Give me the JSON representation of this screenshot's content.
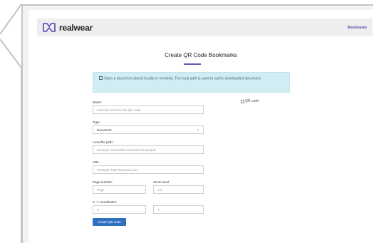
{
  "header": {
    "brand": "realwear",
    "nav_link": "Bookmarks"
  },
  "page": {
    "title": "Create QR Code Bookmarks"
  },
  "alert": {
    "text": "Open a document stored locally or remotely. The local path is used to cache downloaded document."
  },
  "form": {
    "name": {
      "label": "Name:",
      "placeholder": "Friendly name for the QR code"
    },
    "type": {
      "label": "Type:",
      "value": "Document"
    },
    "local_path": {
      "label": "Local file path:",
      "placeholder": "Example: /sdcard/Documents/manual.pdf"
    },
    "url": {
      "label": "URL:",
      "placeholder": "Example: http://example.com"
    },
    "page_number": {
      "label": "Page number:",
      "placeholder": "Page"
    },
    "zoom": {
      "label": "Zoom level:",
      "placeholder": "1-5"
    },
    "coords": {
      "label": "X, Y coordinates:",
      "x_placeholder": "X",
      "y_placeholder": "Y"
    },
    "submit_label": "Create QR code"
  },
  "qr": {
    "alt_text": "QR code"
  },
  "colors": {
    "accent": "#6c55b8",
    "button": "#2f6fc0",
    "alert_bg": "#d1ecf3"
  }
}
